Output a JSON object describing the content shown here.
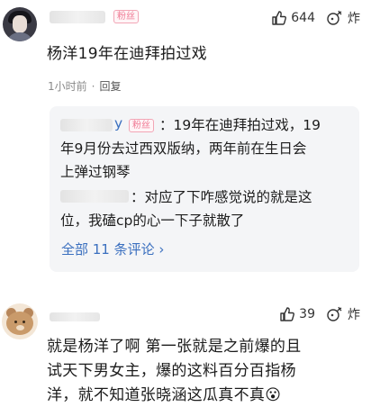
{
  "comment1": {
    "badge": "粉丝",
    "likes": "644",
    "dislike_label": "炸",
    "text": "杨洋19年在迪拜拍过戏",
    "time": "1小时前",
    "reply_label": "回复",
    "replies": [
      {
        "badge": "粉丝",
        "name_tail": "y",
        "line1": "：19年在迪拜拍过戏，19",
        "line2": "年9月份去过西双版纳，两年前在生日会",
        "line3": "上弹过钢琴"
      },
      {
        "line1": "：对应了下咋感觉说的就是这",
        "line2": "位，我磕cp的心一下子就散了"
      }
    ],
    "view_all": "全部 11 条评论 ›"
  },
  "comment2": {
    "likes": "39",
    "dislike_label": "炸",
    "line1": "就是杨洋了啊 第一张就是之前爆的且",
    "line2": "试天下男女主，爆的这料百分百指杨",
    "line3": "洋，就不知道张晓涵这瓜真不真😮"
  },
  "icons": {
    "like": "thumbs-up-icon",
    "bomb": "bomb-icon"
  }
}
